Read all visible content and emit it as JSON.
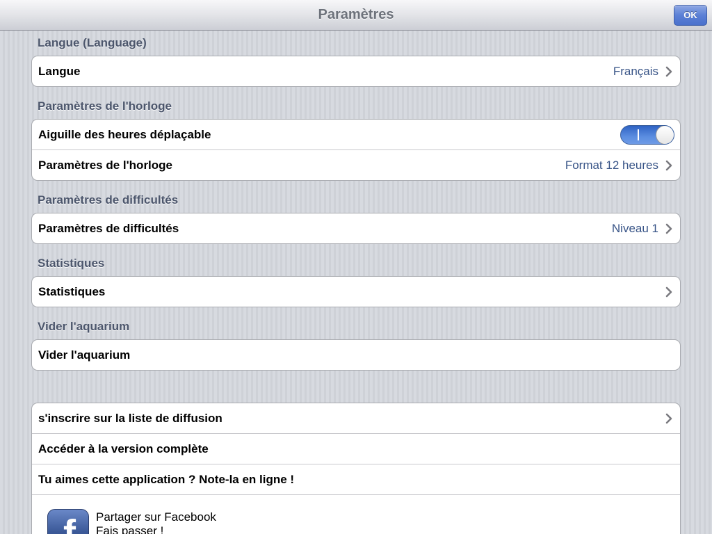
{
  "navbar": {
    "title": "Paramètres",
    "ok_label": "OK"
  },
  "sections": {
    "language": {
      "header": "Langue (Language)",
      "row_label": "Langue",
      "row_value": "Français"
    },
    "clock": {
      "header": "Paramètres de l'horloge",
      "toggle_label": "Aiguille des heures déplaçable",
      "toggle_state": "on",
      "toggle_on_text": "I",
      "format_label": "Paramètres de l'horloge",
      "format_value": "Format 12 heures"
    },
    "difficulty": {
      "header": "Paramètres de difficultés",
      "row_label": "Paramètres de difficultés",
      "row_value": "Niveau 1"
    },
    "stats": {
      "header": "Statistiques",
      "row_label": "Statistiques"
    },
    "aquarium": {
      "header": "Vider l'aquarium",
      "row_label": "Vider l'aquarium"
    },
    "extras": {
      "mailing_label": "s'inscrire sur la liste de diffusion",
      "full_version_label": "Accéder à la version complète",
      "rate_label": "Tu aimes cette application ? Note-la en ligne !",
      "facebook_line1": "Partager sur Facebook",
      "facebook_line2": "Fais passer !",
      "facebook_icon_letter": "f"
    }
  },
  "colors": {
    "accent_blue": "#385487",
    "toggle_blue": "#5b8de0",
    "facebook_blue": "#3b5998"
  }
}
